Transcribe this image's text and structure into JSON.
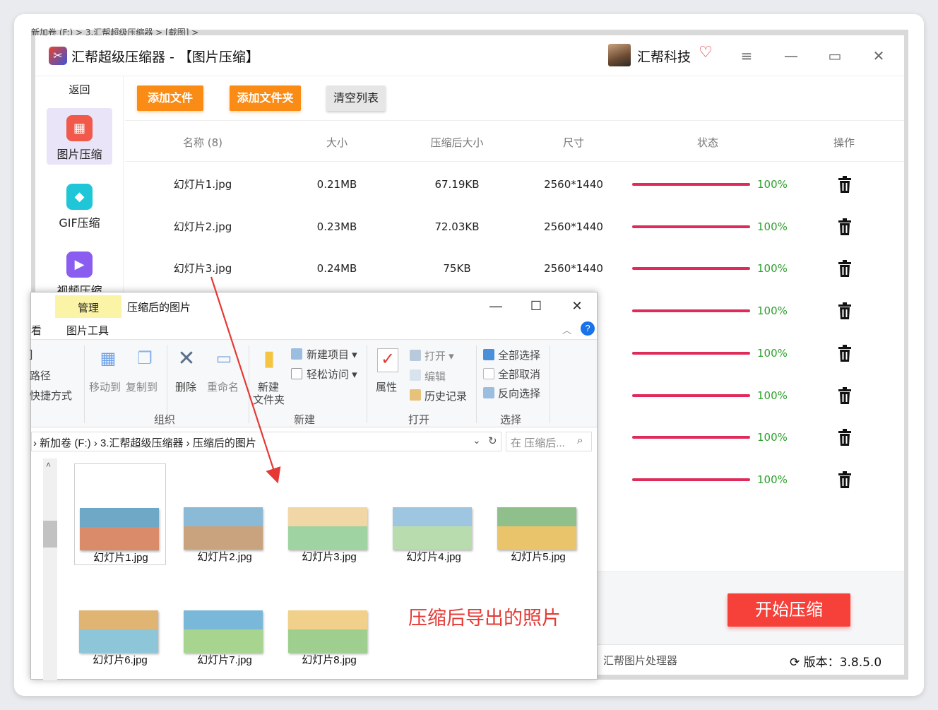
{
  "background_breadcrumb": "新加卷 (F:)  >  3.汇帮超级压缩器  >  [截图]  >",
  "app": {
    "title": "汇帮超级压缩器  -  【图片压缩】",
    "brand": "汇帮科技",
    "icons": {
      "menu": "≡",
      "minimize": "—",
      "maximize": "▭",
      "close": "✕"
    }
  },
  "sidebar": {
    "back": "返回",
    "items": [
      {
        "label": "图片压缩",
        "active": true,
        "color": "#f15a4a"
      },
      {
        "label": "GIF压缩",
        "active": false,
        "color": "#1fc6d8"
      },
      {
        "label": "视频压缩",
        "active": false,
        "color": "#8a5cf0"
      }
    ]
  },
  "toolbar": {
    "add_file": "添加文件",
    "add_folder": "添加文件夹",
    "clear_list": "清空列表"
  },
  "table": {
    "headers": {
      "name": "名称 (8)",
      "size": "大小",
      "compressed": "压缩后大小",
      "dims": "尺寸",
      "status": "状态",
      "ops": "操作"
    },
    "rows": [
      {
        "name": "幻灯片1.jpg",
        "size": "0.21MB",
        "compressed": "67.19KB",
        "dims": "2560*1440",
        "progress": "100%"
      },
      {
        "name": "幻灯片2.jpg",
        "size": "0.23MB",
        "compressed": "72.03KB",
        "dims": "2560*1440",
        "progress": "100%"
      },
      {
        "name": "幻灯片3.jpg",
        "size": "0.24MB",
        "compressed": "75KB",
        "dims": "2560*1440",
        "progress": "100%"
      },
      {
        "name": "",
        "size": "",
        "compressed": "",
        "dims": "",
        "progress": "100%"
      },
      {
        "name": "",
        "size": "",
        "compressed": "",
        "dims": "",
        "progress": "100%"
      },
      {
        "name": "",
        "size": "",
        "compressed": "",
        "dims": "",
        "progress": "100%"
      },
      {
        "name": "",
        "size": "",
        "compressed": "",
        "dims": "",
        "progress": "100%"
      },
      {
        "name": "",
        "size": "",
        "compressed": "",
        "dims": "",
        "progress": "100%"
      }
    ]
  },
  "start_button": "开始压缩",
  "status_bar": {
    "left": "汇帮图片处理器",
    "version": "版本：3.8.5.0"
  },
  "explorer": {
    "title": "压缩后的图片",
    "manage_tab": "管理",
    "tabs": {
      "view": "看",
      "picture_tools": "图片工具"
    },
    "ribbon": {
      "left_items": [
        "]",
        "路径",
        "快捷方式"
      ],
      "move_to": "移动到",
      "copy_to": "复制到",
      "delete": "删除",
      "rename": "重命名",
      "group_organize": "组织",
      "new_folder_line1": "新建",
      "new_folder_line2": "文件夹",
      "new_item": "新建项目",
      "easy_access": "轻松访问",
      "group_new": "新建",
      "properties": "属性",
      "open": "打开",
      "edit": "编辑",
      "history": "历史记录",
      "group_open": "打开",
      "select_all": "全部选择",
      "select_none": "全部取消",
      "invert_selection": "反向选择",
      "group_select": "选择"
    },
    "address": "新加卷 (F:)  ›  3.汇帮超级压缩器  ›  压缩后的图片",
    "search_placeholder": "在 压缩后...",
    "files": [
      "幻灯片1.jpg",
      "幻灯片2.jpg",
      "幻灯片3.jpg",
      "幻灯片4.jpg",
      "幻灯片5.jpg",
      "幻灯片6.jpg",
      "幻灯片7.jpg",
      "幻灯片8.jpg"
    ]
  },
  "annotation": "压缩后导出的照片",
  "colors": {
    "accent_orange": "#fa8c16",
    "start_red": "#f5413a",
    "progress_bar": "#e02b5a",
    "progress_text": "#2ca02c",
    "arrow": "#e53935"
  }
}
